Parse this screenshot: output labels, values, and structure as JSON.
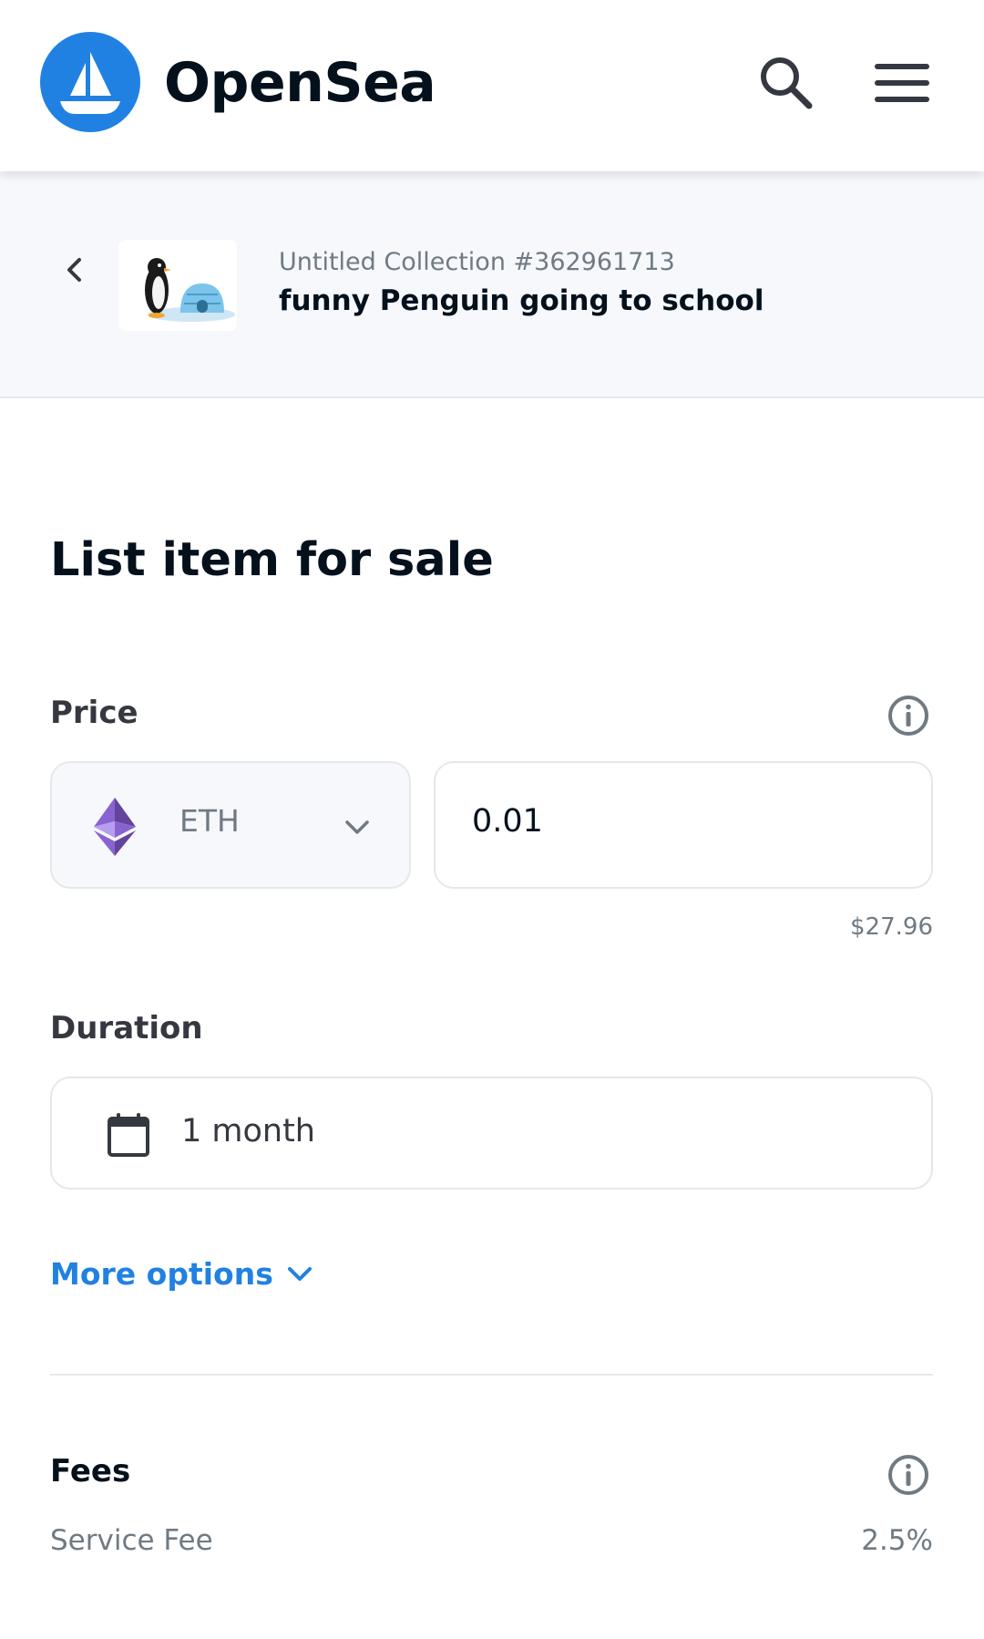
{
  "header": {
    "brand": "OpenSea",
    "logo_icon": "opensea-ship-icon",
    "search_icon": "search-icon",
    "menu_icon": "hamburger-menu-icon"
  },
  "item": {
    "back_icon": "chevron-left-icon",
    "thumbnail": "penguin-igloo-thumbnail",
    "collection": "Untitled Collection #362961713",
    "name": "funny Penguin going to school"
  },
  "form": {
    "title": "List item for sale",
    "price_label": "Price",
    "currency": "ETH",
    "currency_icon": "ethereum-icon",
    "price_value": "0.01",
    "price_usd": "$27.96",
    "duration_label": "Duration",
    "duration_value": "1 month",
    "duration_icon": "calendar-icon",
    "more_options": "More options",
    "fees_label": "Fees",
    "service_fee_label": "Service Fee",
    "service_fee_value": "2.5%"
  },
  "colors": {
    "brand_blue": "#2081e2",
    "ethereum_purple": "#8a63d2",
    "text_dark": "#04111d",
    "text_muted": "#707a83"
  }
}
